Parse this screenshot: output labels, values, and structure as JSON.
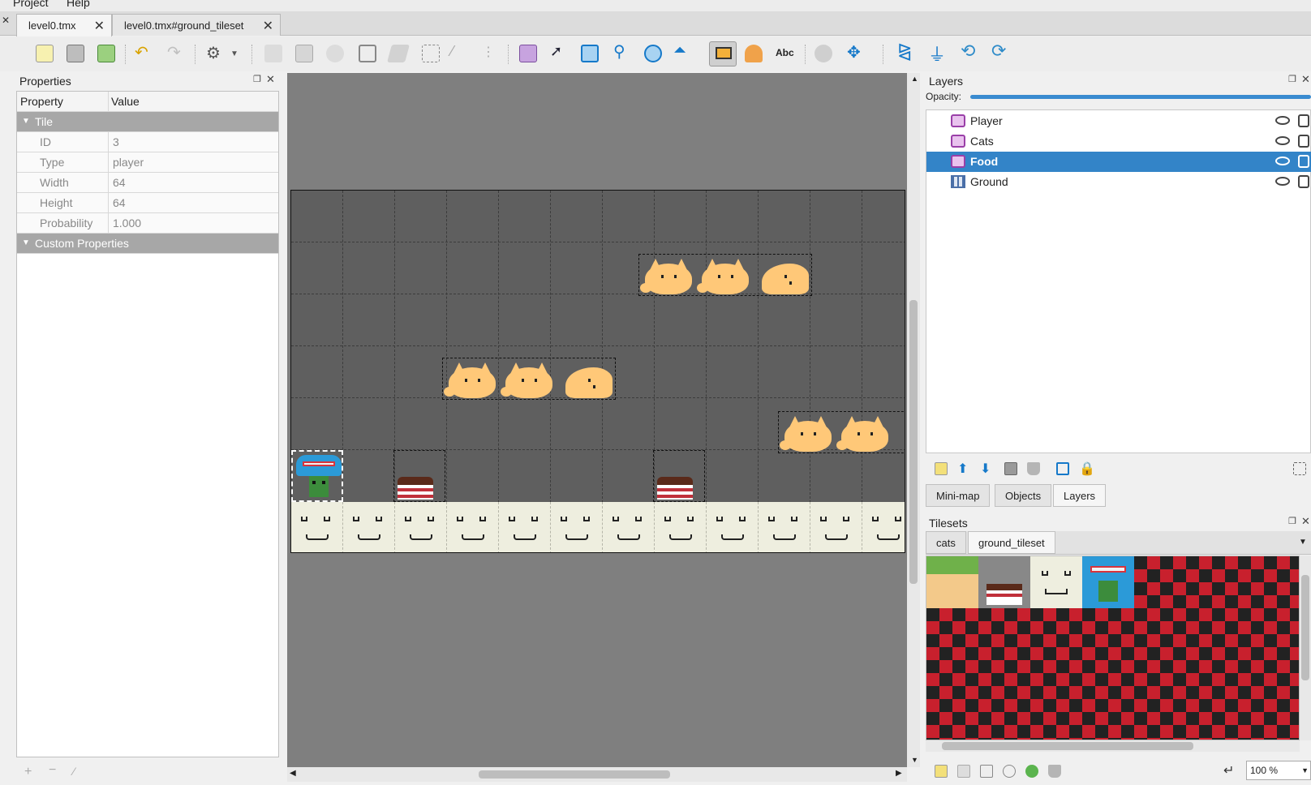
{
  "menu": {
    "items": [
      "Project",
      "Help"
    ]
  },
  "tabs": [
    {
      "label": "level0.tmx",
      "close": "✕"
    },
    {
      "label": "level0.tmx#ground_tileset",
      "close": "✕"
    }
  ],
  "properties": {
    "title": "Properties",
    "col_property": "Property",
    "col_value": "Value",
    "group_tile": "Tile",
    "rows": [
      {
        "key": "ID",
        "value": "3"
      },
      {
        "key": "Type",
        "value": "player"
      },
      {
        "key": "Width",
        "value": "64"
      },
      {
        "key": "Height",
        "value": "64"
      },
      {
        "key": "Probability",
        "value": "1.000"
      }
    ],
    "group_custom": "Custom Properties"
  },
  "layers": {
    "title": "Layers",
    "opacity_label": "Opacity:",
    "opacity_value": 100,
    "items": [
      {
        "name": "Player",
        "icon": "object-layer-icon",
        "selected": false
      },
      {
        "name": "Cats",
        "icon": "object-layer-icon",
        "selected": false
      },
      {
        "name": "Food",
        "icon": "object-layer-icon",
        "selected": true
      },
      {
        "name": "Ground",
        "icon": "tile-layer-icon",
        "selected": false
      }
    ]
  },
  "panel_tabs": [
    "Mini-map",
    "Objects",
    "Layers"
  ],
  "tilesets": {
    "title": "Tilesets",
    "tabs": [
      "cats",
      "ground_tileset"
    ],
    "zoom": "100 %"
  },
  "colors": {
    "selection": "#3384c8",
    "map_bg": "#5f5f5f",
    "view_bg": "#7f7f7f",
    "cat": "#ffc878",
    "ground": "#eeeedf",
    "tileset_red": "#c8202d"
  }
}
